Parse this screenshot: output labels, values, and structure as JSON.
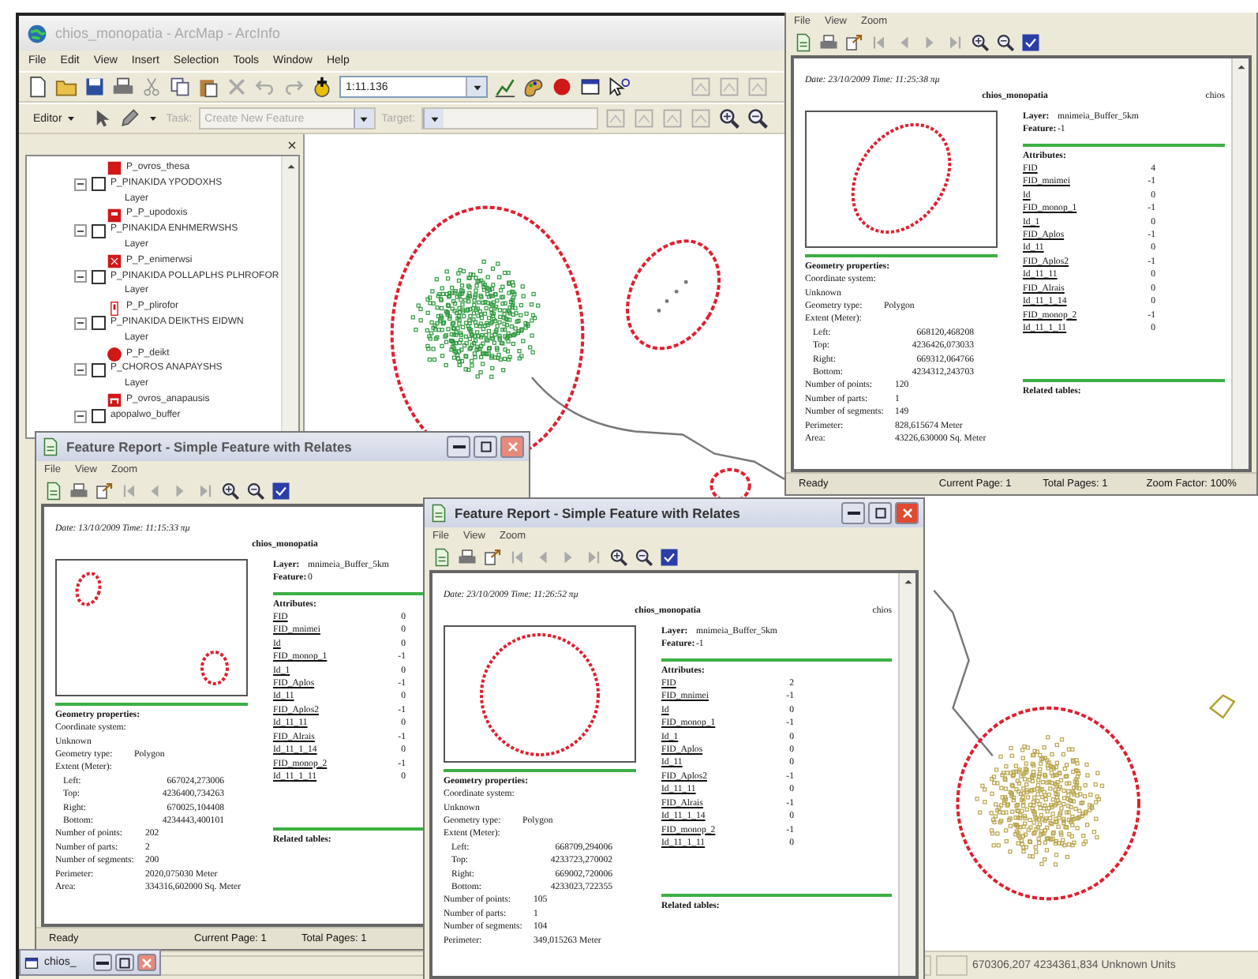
{
  "main_window": {
    "title": "chios_monopatia - ArcMap - ArcInfo",
    "menus": [
      "File",
      "Edit",
      "View",
      "Insert",
      "Selection",
      "Tools",
      "Window",
      "Help"
    ],
    "scale": "1:11.136",
    "editor": {
      "label": "Editor",
      "task_label": "Task:",
      "task": "Create New Feature",
      "target_label": "Target:"
    },
    "toc": [
      {
        "kind": "legend",
        "label": "P_ovros_thesa",
        "symbol": {
          "kind": "square"
        }
      },
      {
        "kind": "layer",
        "name": "P_PINAKIDA YPODOXHS",
        "checked": false,
        "expanded": true,
        "children": [
          {
            "kind": "heading",
            "label": "Layer"
          },
          {
            "kind": "legend",
            "label": "P_P_upodoxis",
            "symbol": {
              "kind": "sign"
            }
          }
        ]
      },
      {
        "kind": "layer",
        "name": "P_PINAKIDA ENHMERWSHS",
        "checked": false,
        "expanded": true,
        "children": [
          {
            "kind": "heading",
            "label": "Layer"
          },
          {
            "kind": "legend",
            "label": "P_P_enimerwsi",
            "symbol": {
              "kind": "board"
            }
          }
        ]
      },
      {
        "kind": "layer",
        "name": "P_PINAKIDA POLLAPLHS PLHROFOR",
        "checked": false,
        "expanded": true,
        "children": [
          {
            "kind": "heading",
            "label": "Layer"
          },
          {
            "kind": "legend",
            "label": "P_P_plirofor",
            "symbol": {
              "kind": "marker"
            }
          }
        ]
      },
      {
        "kind": "layer",
        "name": "P_PINAKIDA DEIKTHS EIDWN",
        "checked": false,
        "expanded": true,
        "children": [
          {
            "kind": "heading",
            "label": "Layer"
          },
          {
            "kind": "legend",
            "label": "P_P_deikt",
            "symbol": {
              "kind": "dot"
            }
          }
        ]
      },
      {
        "kind": "layer",
        "name": "P_CHOROS ANAPAYSHS",
        "checked": false,
        "expanded": true,
        "children": [
          {
            "kind": "heading",
            "label": "Layer"
          },
          {
            "kind": "legend",
            "label": "P_ovros_anapausis",
            "symbol": {
              "kind": "bench"
            }
          }
        ]
      },
      {
        "kind": "layer",
        "name": "apopalwo_buffer",
        "checked": false,
        "expanded": true
      }
    ],
    "status": "670306,207 4234361,834 Unknown Units"
  },
  "reports": [
    {
      "menus": [
        "File",
        "View",
        "Zoom"
      ],
      "date": "Date: 23/10/2009 Time: 11:25:38 πμ",
      "heading": "chios_monopatia",
      "corner": "chios",
      "layer_label": "Layer:",
      "layer": "mnimeia_Buffer_5km",
      "feature_label": "Feature:",
      "feature": "-1",
      "attributes_title": "Attributes:",
      "attributes": [
        {
          "name": "FID",
          "value": "4"
        },
        {
          "name": "FID_mnimei",
          "value": "-1"
        },
        {
          "name": "Id",
          "value": "0"
        },
        {
          "name": "FID_monop_1",
          "value": "-1"
        },
        {
          "name": "Id_1",
          "value": "0"
        },
        {
          "name": "FID_Aplos",
          "value": "-1"
        },
        {
          "name": "Id_11",
          "value": "0"
        },
        {
          "name": "FID_Aplos2",
          "value": "-1"
        },
        {
          "name": "Id_11_11",
          "value": "0"
        },
        {
          "name": "FID_Alrais",
          "value": "0"
        },
        {
          "name": "Id_11_1_14",
          "value": "0"
        },
        {
          "name": "FID_monop_2",
          "value": "-1"
        },
        {
          "name": "Id_11_1_11",
          "value": "0"
        }
      ],
      "geometry_title": "Geometry properties:",
      "coordinate_label": "Coordinate system:",
      "coordinate": "Unknown",
      "geometry_type_label": "Geometry type:",
      "geometry_type": "Polygon",
      "extent_label": "Extent (Meter):",
      "extent": [
        {
          "label": "Left:",
          "value": "668120,468208"
        },
        {
          "label": "Top:",
          "value": "4236426,073033"
        },
        {
          "label": "Right:",
          "value": "669312,064766"
        },
        {
          "label": "Bottom:",
          "value": "4234312,243703"
        }
      ],
      "counts": [
        {
          "label": "Number of points:",
          "value": "120"
        },
        {
          "label": "Number of parts:",
          "value": "1"
        },
        {
          "label": "Number of segments:",
          "value": "149"
        },
        {
          "label": "Perimeter:",
          "value": "828,615674 Meter"
        },
        {
          "label": "Area:",
          "value": "43226,630000 Sq. Meter"
        }
      ],
      "related_title": "Related tables:",
      "status": [
        "Ready",
        "Current Page: 1",
        "Total Pages: 1",
        "Zoom Factor: 100%"
      ]
    },
    {
      "title": "Feature Report - Simple Feature with Relates",
      "menus": [
        "File",
        "View",
        "Zoom"
      ],
      "date": "Date: 13/10/2009 Time: 11:15:33 πμ",
      "heading": "chios_monopatia",
      "layer_label": "Layer:",
      "layer": "mnimeia_Buffer_5km",
      "feature_label": "Feature:",
      "feature": "0",
      "attributes_title": "Attributes:",
      "attributes": [
        {
          "name": "FID",
          "value": "0"
        },
        {
          "name": "FID_mnimei",
          "value": "0"
        },
        {
          "name": "Id",
          "value": "0"
        },
        {
          "name": "FID_monop_1",
          "value": "-1"
        },
        {
          "name": "Id_1",
          "value": "0"
        },
        {
          "name": "FID_Aplos",
          "value": "-1"
        },
        {
          "name": "Id_11",
          "value": "0"
        },
        {
          "name": "FID_Aplos2",
          "value": "-1"
        },
        {
          "name": "Id_11_11",
          "value": "0"
        },
        {
          "name": "FID_Alrais",
          "value": "-1"
        },
        {
          "name": "Id_11_1_14",
          "value": "0"
        },
        {
          "name": "FID_monop_2",
          "value": "-1"
        },
        {
          "name": "Id_11_1_11",
          "value": "0"
        }
      ],
      "geometry_title": "Geometry properties:",
      "coordinate_label": "Coordinate system:",
      "coordinate": "Unknown",
      "geometry_type_label": "Geometry type:",
      "geometry_type": "Polygon",
      "extent_label": "Extent (Meter):",
      "extent": [
        {
          "label": "Left:",
          "value": "667024,273006"
        },
        {
          "label": "Top:",
          "value": "4236400,734263"
        },
        {
          "label": "Right:",
          "value": "670025,104408"
        },
        {
          "label": "Bottom:",
          "value": "4234443,400101"
        }
      ],
      "counts": [
        {
          "label": "Number of points:",
          "value": "202"
        },
        {
          "label": "Number of parts:",
          "value": "2"
        },
        {
          "label": "Number of segments:",
          "value": "200"
        },
        {
          "label": "Perimeter:",
          "value": "2020,075030 Meter"
        },
        {
          "label": "Area:",
          "value": "334316,602000 Sq. Meter"
        }
      ],
      "related_title": "Related tables:",
      "status": [
        "Ready",
        "Current Page: 1",
        "Total Pages: 1"
      ]
    },
    {
      "title": "Feature Report - Simple Feature with Relates",
      "menus": [
        "File",
        "View",
        "Zoom"
      ],
      "date": "Date: 23/10/2009 Time: 11:26:52 πμ",
      "heading": "chios_monopatia",
      "corner": "chios",
      "layer_label": "Layer:",
      "layer": "mnimeia_Buffer_5km",
      "feature_label": "Feature:",
      "feature": "-1",
      "attributes_title": "Attributes:",
      "attributes": [
        {
          "name": "FID",
          "value": "2"
        },
        {
          "name": "FID_mnimei",
          "value": "-1"
        },
        {
          "name": "Id",
          "value": "0"
        },
        {
          "name": "FID_monop_1",
          "value": "-1"
        },
        {
          "name": "Id_1",
          "value": "0"
        },
        {
          "name": "FID_Aplos",
          "value": "0"
        },
        {
          "name": "Id_11",
          "value": "0"
        },
        {
          "name": "FID_Aplos2",
          "value": "-1"
        },
        {
          "name": "Id_11_11",
          "value": "0"
        },
        {
          "name": "FID_Alrais",
          "value": "-1"
        },
        {
          "name": "Id_11_1_14",
          "value": "0"
        },
        {
          "name": "FID_monop_2",
          "value": "-1"
        },
        {
          "name": "Id_11_1_11",
          "value": "0"
        }
      ],
      "geometry_title": "Geometry properties:",
      "coordinate_label": "Coordinate system:",
      "coordinate": "Unknown",
      "geometry_type_label": "Geometry type:",
      "geometry_type": "Polygon",
      "extent_label": "Extent (Meter):",
      "extent": [
        {
          "label": "Left:",
          "value": "668709,294006"
        },
        {
          "label": "Top:",
          "value": "4233723,270002"
        },
        {
          "label": "Right:",
          "value": "669002,720006"
        },
        {
          "label": "Bottom:",
          "value": "4233023,722355"
        }
      ],
      "counts": [
        {
          "label": "Number of points:",
          "value": "105"
        },
        {
          "label": "Number of parts:",
          "value": "1"
        },
        {
          "label": "Number of segments:",
          "value": "104"
        },
        {
          "label": "Perimeter:",
          "value": "349,015263 Meter"
        }
      ],
      "related_title": "Related tables:"
    }
  ],
  "minimized_window": {
    "title": "chios_"
  }
}
